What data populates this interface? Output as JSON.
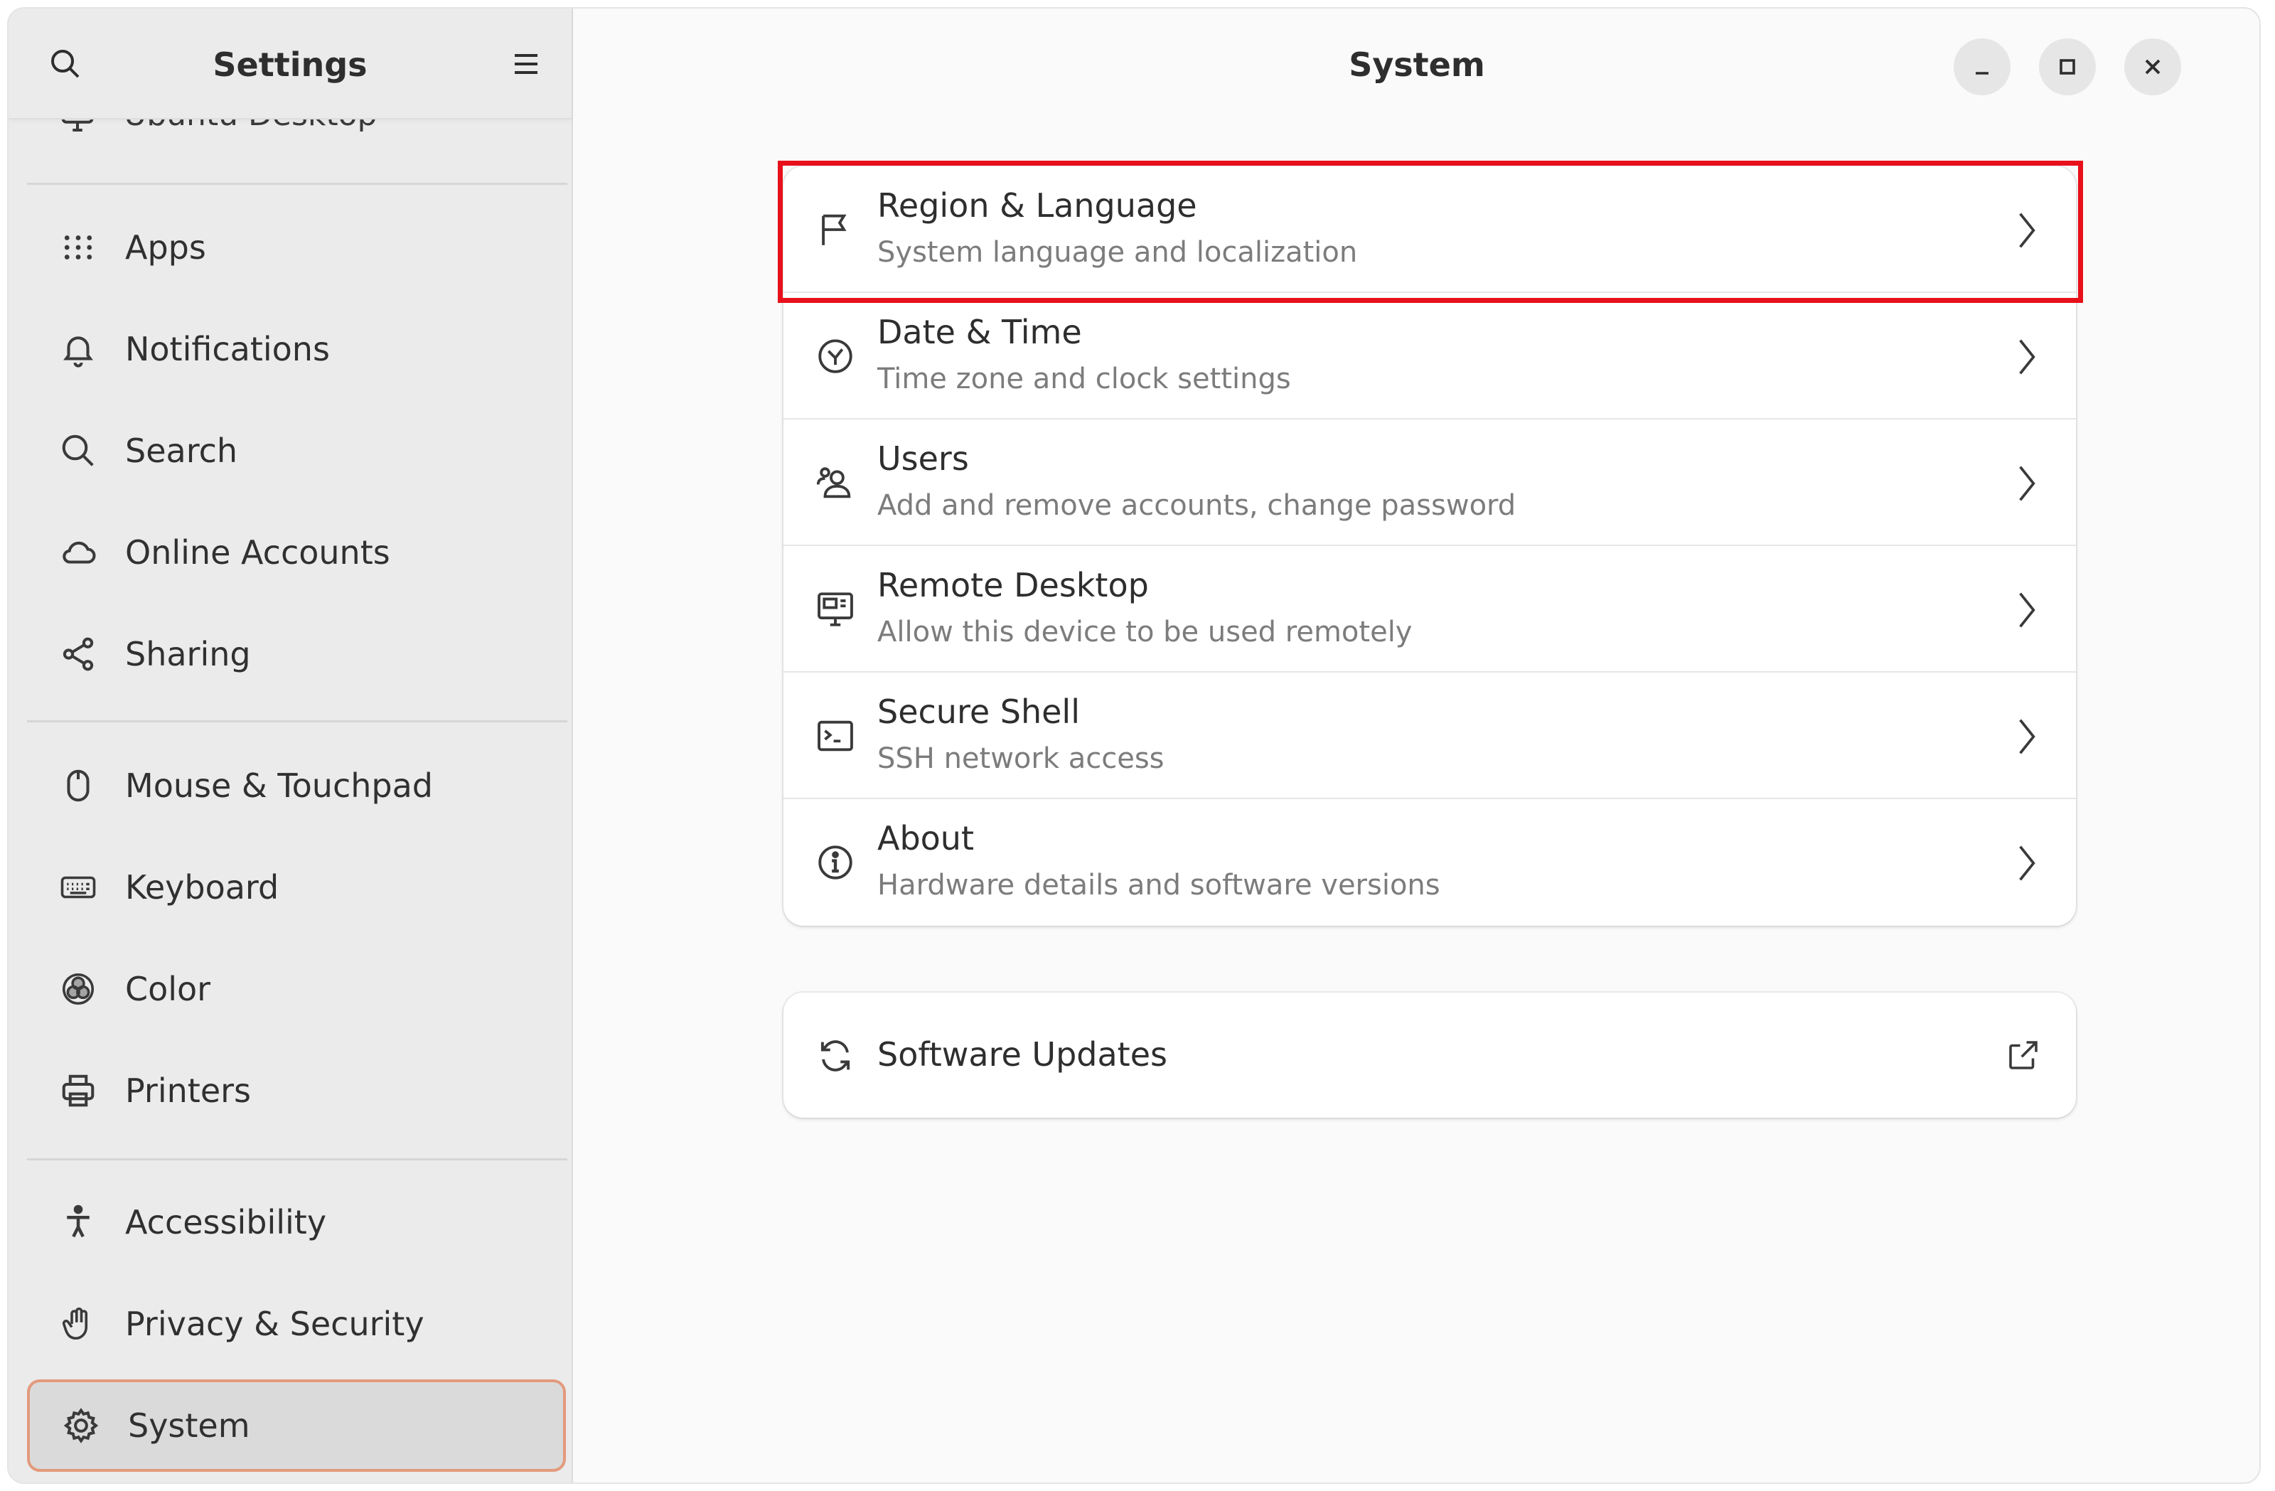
{
  "window": {
    "accent": "#e39a7c",
    "highlight_color": "#e8101a"
  },
  "sidebar": {
    "title": "Settings",
    "cut_item": {
      "label": "Ubuntu Desktop",
      "icon": "desktop-icon"
    },
    "items": [
      {
        "label": "Apps",
        "icon": "apps-grid-icon"
      },
      {
        "label": "Notifications",
        "icon": "bell-icon"
      },
      {
        "label": "Search",
        "icon": "search-icon"
      },
      {
        "label": "Online Accounts",
        "icon": "cloud-icon"
      },
      {
        "label": "Sharing",
        "icon": "share-icon"
      },
      {
        "label": "Mouse & Touchpad",
        "icon": "mouse-icon"
      },
      {
        "label": "Keyboard",
        "icon": "keyboard-icon"
      },
      {
        "label": "Color",
        "icon": "color-icon"
      },
      {
        "label": "Printers",
        "icon": "printer-icon"
      },
      {
        "label": "Accessibility",
        "icon": "accessibility-icon"
      },
      {
        "label": "Privacy & Security",
        "icon": "hand-icon"
      },
      {
        "label": "System",
        "icon": "gear-icon",
        "selected": true
      }
    ]
  },
  "content": {
    "title": "System",
    "rows": [
      {
        "title": "Region & Language",
        "subtitle": "System language and localization",
        "icon": "flag-icon"
      },
      {
        "title": "Date & Time",
        "subtitle": "Time zone and clock settings",
        "icon": "clock-icon"
      },
      {
        "title": "Users",
        "subtitle": "Add and remove accounts, change password",
        "icon": "users-icon"
      },
      {
        "title": "Remote Desktop",
        "subtitle": "Allow this device to be used remotely",
        "icon": "remote-desktop-icon"
      },
      {
        "title": "Secure Shell",
        "subtitle": "SSH network access",
        "icon": "terminal-icon"
      },
      {
        "title": "About",
        "subtitle": "Hardware details and software versions",
        "icon": "info-icon"
      }
    ],
    "software_updates": {
      "title": "Software Updates",
      "icon": "refresh-icon"
    }
  }
}
